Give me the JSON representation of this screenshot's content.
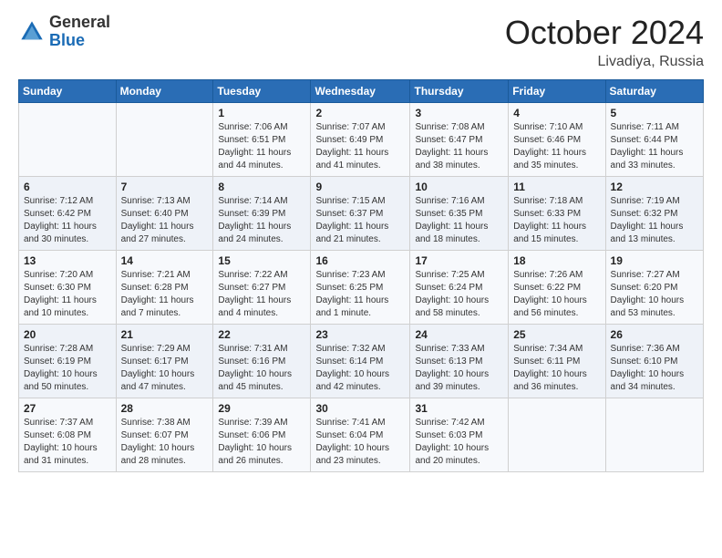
{
  "header": {
    "logo": {
      "general": "General",
      "blue": "Blue"
    },
    "title": "October 2024",
    "location": "Livadiya, Russia"
  },
  "weekdays": [
    "Sunday",
    "Monday",
    "Tuesday",
    "Wednesday",
    "Thursday",
    "Friday",
    "Saturday"
  ],
  "weeks": [
    [
      {
        "day": "",
        "info": ""
      },
      {
        "day": "",
        "info": ""
      },
      {
        "day": "1",
        "info": "Sunrise: 7:06 AM\nSunset: 6:51 PM\nDaylight: 11 hours and 44 minutes."
      },
      {
        "day": "2",
        "info": "Sunrise: 7:07 AM\nSunset: 6:49 PM\nDaylight: 11 hours and 41 minutes."
      },
      {
        "day": "3",
        "info": "Sunrise: 7:08 AM\nSunset: 6:47 PM\nDaylight: 11 hours and 38 minutes."
      },
      {
        "day": "4",
        "info": "Sunrise: 7:10 AM\nSunset: 6:46 PM\nDaylight: 11 hours and 35 minutes."
      },
      {
        "day": "5",
        "info": "Sunrise: 7:11 AM\nSunset: 6:44 PM\nDaylight: 11 hours and 33 minutes."
      }
    ],
    [
      {
        "day": "6",
        "info": "Sunrise: 7:12 AM\nSunset: 6:42 PM\nDaylight: 11 hours and 30 minutes."
      },
      {
        "day": "7",
        "info": "Sunrise: 7:13 AM\nSunset: 6:40 PM\nDaylight: 11 hours and 27 minutes."
      },
      {
        "day": "8",
        "info": "Sunrise: 7:14 AM\nSunset: 6:39 PM\nDaylight: 11 hours and 24 minutes."
      },
      {
        "day": "9",
        "info": "Sunrise: 7:15 AM\nSunset: 6:37 PM\nDaylight: 11 hours and 21 minutes."
      },
      {
        "day": "10",
        "info": "Sunrise: 7:16 AM\nSunset: 6:35 PM\nDaylight: 11 hours and 18 minutes."
      },
      {
        "day": "11",
        "info": "Sunrise: 7:18 AM\nSunset: 6:33 PM\nDaylight: 11 hours and 15 minutes."
      },
      {
        "day": "12",
        "info": "Sunrise: 7:19 AM\nSunset: 6:32 PM\nDaylight: 11 hours and 13 minutes."
      }
    ],
    [
      {
        "day": "13",
        "info": "Sunrise: 7:20 AM\nSunset: 6:30 PM\nDaylight: 11 hours and 10 minutes."
      },
      {
        "day": "14",
        "info": "Sunrise: 7:21 AM\nSunset: 6:28 PM\nDaylight: 11 hours and 7 minutes."
      },
      {
        "day": "15",
        "info": "Sunrise: 7:22 AM\nSunset: 6:27 PM\nDaylight: 11 hours and 4 minutes."
      },
      {
        "day": "16",
        "info": "Sunrise: 7:23 AM\nSunset: 6:25 PM\nDaylight: 11 hours and 1 minute."
      },
      {
        "day": "17",
        "info": "Sunrise: 7:25 AM\nSunset: 6:24 PM\nDaylight: 10 hours and 58 minutes."
      },
      {
        "day": "18",
        "info": "Sunrise: 7:26 AM\nSunset: 6:22 PM\nDaylight: 10 hours and 56 minutes."
      },
      {
        "day": "19",
        "info": "Sunrise: 7:27 AM\nSunset: 6:20 PM\nDaylight: 10 hours and 53 minutes."
      }
    ],
    [
      {
        "day": "20",
        "info": "Sunrise: 7:28 AM\nSunset: 6:19 PM\nDaylight: 10 hours and 50 minutes."
      },
      {
        "day": "21",
        "info": "Sunrise: 7:29 AM\nSunset: 6:17 PM\nDaylight: 10 hours and 47 minutes."
      },
      {
        "day": "22",
        "info": "Sunrise: 7:31 AM\nSunset: 6:16 PM\nDaylight: 10 hours and 45 minutes."
      },
      {
        "day": "23",
        "info": "Sunrise: 7:32 AM\nSunset: 6:14 PM\nDaylight: 10 hours and 42 minutes."
      },
      {
        "day": "24",
        "info": "Sunrise: 7:33 AM\nSunset: 6:13 PM\nDaylight: 10 hours and 39 minutes."
      },
      {
        "day": "25",
        "info": "Sunrise: 7:34 AM\nSunset: 6:11 PM\nDaylight: 10 hours and 36 minutes."
      },
      {
        "day": "26",
        "info": "Sunrise: 7:36 AM\nSunset: 6:10 PM\nDaylight: 10 hours and 34 minutes."
      }
    ],
    [
      {
        "day": "27",
        "info": "Sunrise: 7:37 AM\nSunset: 6:08 PM\nDaylight: 10 hours and 31 minutes."
      },
      {
        "day": "28",
        "info": "Sunrise: 7:38 AM\nSunset: 6:07 PM\nDaylight: 10 hours and 28 minutes."
      },
      {
        "day": "29",
        "info": "Sunrise: 7:39 AM\nSunset: 6:06 PM\nDaylight: 10 hours and 26 minutes."
      },
      {
        "day": "30",
        "info": "Sunrise: 7:41 AM\nSunset: 6:04 PM\nDaylight: 10 hours and 23 minutes."
      },
      {
        "day": "31",
        "info": "Sunrise: 7:42 AM\nSunset: 6:03 PM\nDaylight: 10 hours and 20 minutes."
      },
      {
        "day": "",
        "info": ""
      },
      {
        "day": "",
        "info": ""
      }
    ]
  ]
}
